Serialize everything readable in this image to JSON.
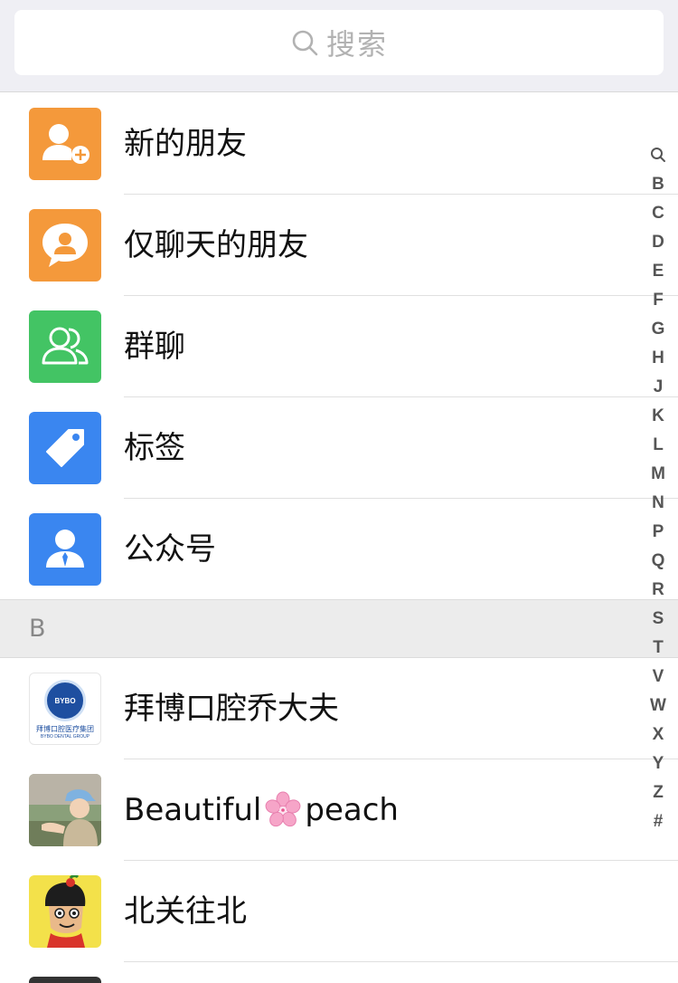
{
  "search": {
    "placeholder": "搜索"
  },
  "shortcuts": [
    {
      "label": "新的朋友",
      "icon": "add-friend-icon",
      "color": "#f4993b"
    },
    {
      "label": "仅聊天的朋友",
      "icon": "chat-only-friend-icon",
      "color": "#f4993b"
    },
    {
      "label": "群聊",
      "icon": "group-chat-icon",
      "color": "#43c464"
    },
    {
      "label": "标签",
      "icon": "tag-icon",
      "color": "#3a86f0"
    },
    {
      "label": "公众号",
      "icon": "official-account-icon",
      "color": "#3a86f0"
    }
  ],
  "section": {
    "letter": "B"
  },
  "contacts": [
    {
      "name": "拜博口腔乔大夫",
      "avatar": "bybo-dental-logo",
      "avatar_text": "拜博口腔医疗集团",
      "avatar_text_en": "BYBO DENTAL GROUP",
      "avatar_badge": "BYBO"
    },
    {
      "name_prefix": "Beautiful",
      "name_emoji": "cherry-blossom-icon",
      "name_suffix": "peach",
      "avatar": "baby-photo"
    },
    {
      "name": "北关往北",
      "avatar": "cartoon-boy-avatar"
    }
  ],
  "index_letters": [
    "Q",
    "B",
    "C",
    "D",
    "E",
    "F",
    "G",
    "H",
    "J",
    "K",
    "L",
    "M",
    "N",
    "P",
    "Q",
    "R",
    "S",
    "T",
    "V",
    "W",
    "X",
    "Y",
    "Z",
    "#"
  ],
  "colors": {
    "background": "#ffffff",
    "search_bg": "#efeff4",
    "section_bg": "#ececec"
  }
}
